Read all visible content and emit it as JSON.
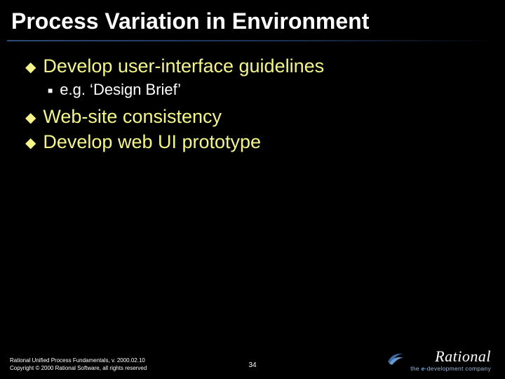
{
  "title": "Process Variation in Environment",
  "bullets": {
    "b1": "Develop user-interface guidelines",
    "b1_sub1": "e.g. ‘Design Brief’",
    "b2": "Web-site consistency",
    "b3": "Develop web UI prototype"
  },
  "footer": {
    "line1": "Rational Unified Process Fundamentals, v. 2000.02.10",
    "line2": "Copyright © 2000 Rational Software, all rights reserved",
    "page": "34"
  },
  "brand": {
    "name": "Rational",
    "tag_prefix": "the ",
    "tag_e": "e",
    "tag_suffix": "-development company"
  }
}
